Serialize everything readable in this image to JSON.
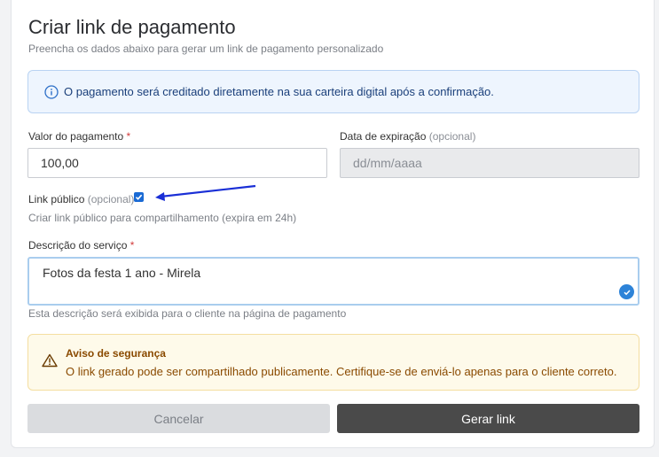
{
  "header": {
    "title": "Criar link de pagamento",
    "subtitle": "Preencha os dados abaixo para gerar um link de pagamento personalizado"
  },
  "info_banner": {
    "icon": "info-icon",
    "text": "O pagamento será creditado diretamente na sua carteira digital após a confirmação."
  },
  "amount": {
    "label": "Valor do pagamento",
    "required_mark": "*",
    "value": "100,00"
  },
  "expiry": {
    "label": "Data de expiração",
    "optional": "(opcional)",
    "placeholder": "dd/mm/aaaa"
  },
  "public_link": {
    "label": "Link público",
    "optional": "(opcional)",
    "checked": true,
    "hint": "Criar link público para compartilhamento (expira em 24h)"
  },
  "description": {
    "label": "Descrição do serviço",
    "required_mark": "*",
    "value": "Fotos da festa 1 ano - Mirela",
    "hint": "Esta descrição será exibida para o cliente na página de pagamento"
  },
  "security_notice": {
    "icon": "warning-icon",
    "title": "Aviso de segurança",
    "text": "O link gerado pode ser compartilhado publicamente. Certifique-se de enviá-lo apenas para o cliente correto."
  },
  "actions": {
    "cancel_label": "Cancelar",
    "submit_label": "Gerar link"
  },
  "colors": {
    "accent": "#1a6ad4",
    "primary_button": "#4a4a4a",
    "info_bg": "#eef5fe",
    "warning_bg": "#fefaea",
    "annotation_arrow": "#1a2fd6"
  }
}
